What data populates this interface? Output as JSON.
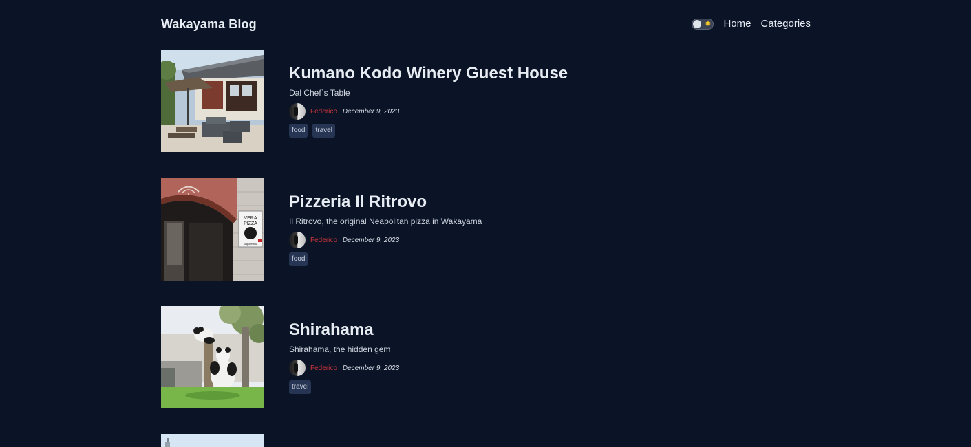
{
  "header": {
    "brand": "Wakayama Blog",
    "nav": [
      {
        "label": "Home"
      },
      {
        "label": "Categories"
      }
    ]
  },
  "posts": [
    {
      "title": "Kumano Kodo Winery Guest House",
      "subtitle": "Dal Chef`s Table",
      "author": "Federico",
      "date": "December 9, 2023",
      "tags": [
        "food",
        "travel"
      ]
    },
    {
      "title": "Pizzeria Il Ritrovo",
      "subtitle": "Il Ritrovo, the original Neapolitan pizza in Wakayama",
      "author": "Federico",
      "date": "December 9, 2023",
      "tags": [
        "food"
      ]
    },
    {
      "title": "Shirahama",
      "subtitle": "Shirahama, the hidden gem",
      "author": "Federico",
      "date": "December 9, 2023",
      "tags": [
        "travel"
      ]
    }
  ],
  "image_text": {
    "sign": [
      "VERA",
      "PIZZA",
      "Napoletana"
    ]
  },
  "colors": {
    "background": "#0b1426",
    "author": "#c8343a",
    "tag_bg": "#263554"
  }
}
